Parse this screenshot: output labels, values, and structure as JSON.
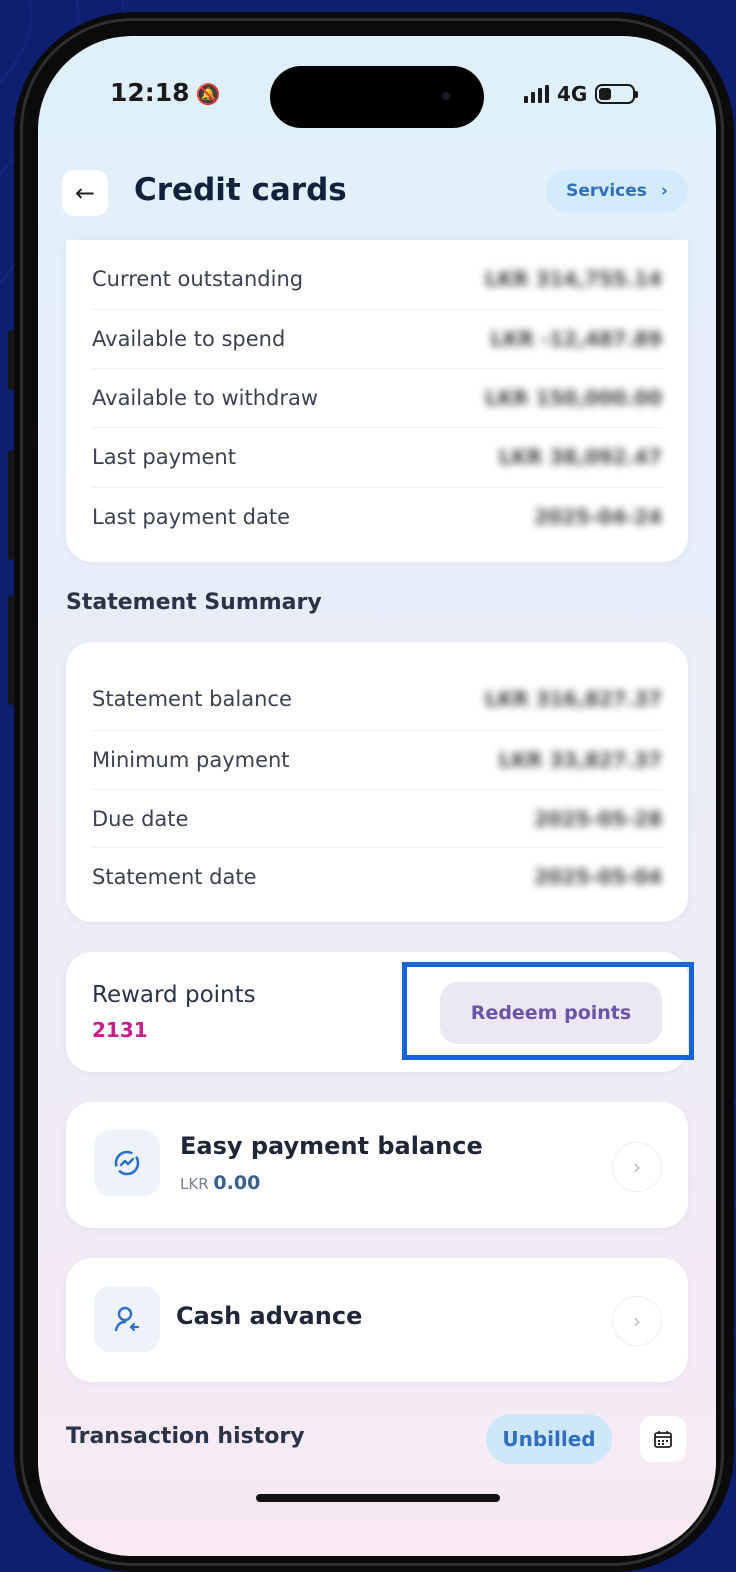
{
  "status_bar": {
    "time": "12:18",
    "network": "4G",
    "bell_icon": "bell-slash-icon"
  },
  "header": {
    "title": "Credit cards",
    "back_icon": "arrow-left-icon",
    "services_label": "Services",
    "services_chevron": "›"
  },
  "account_details": [
    {
      "label": "Current outstanding",
      "value": "LKR 314,755.14"
    },
    {
      "label": "Available to spend",
      "value": "LKR -12,487.89"
    },
    {
      "label": "Available to withdraw",
      "value": "LKR 150,000.00"
    },
    {
      "label": "Last payment",
      "value": "LKR 38,092.47"
    },
    {
      "label": "Last payment date",
      "value": "2025-04-24"
    }
  ],
  "statement_summary": {
    "title": "Statement Summary",
    "rows": [
      {
        "label": "Statement balance",
        "value": "LKR 316,827.37"
      },
      {
        "label": "Minimum payment",
        "value": "LKR 33,827.37"
      },
      {
        "label": "Due date",
        "value": "2025-05-28"
      },
      {
        "label": "Statement date",
        "value": "2025-05-04"
      }
    ]
  },
  "rewards": {
    "label": "Reward points",
    "value": "2131",
    "redeem_label": "Redeem  points"
  },
  "easy_payment": {
    "title": "Easy payment balance",
    "currency": "LKR",
    "amount": "0.00",
    "chevron": "›"
  },
  "cash_advance": {
    "title": "Cash advance",
    "chevron": "›"
  },
  "transaction_history": {
    "title": "Transaction history",
    "filter_label": "Unbilled"
  },
  "colors": {
    "accent": "#2f6fc0",
    "points": "#c81e8c",
    "highlight": "#1565d8",
    "frame_bg": "#0d1f6e"
  }
}
